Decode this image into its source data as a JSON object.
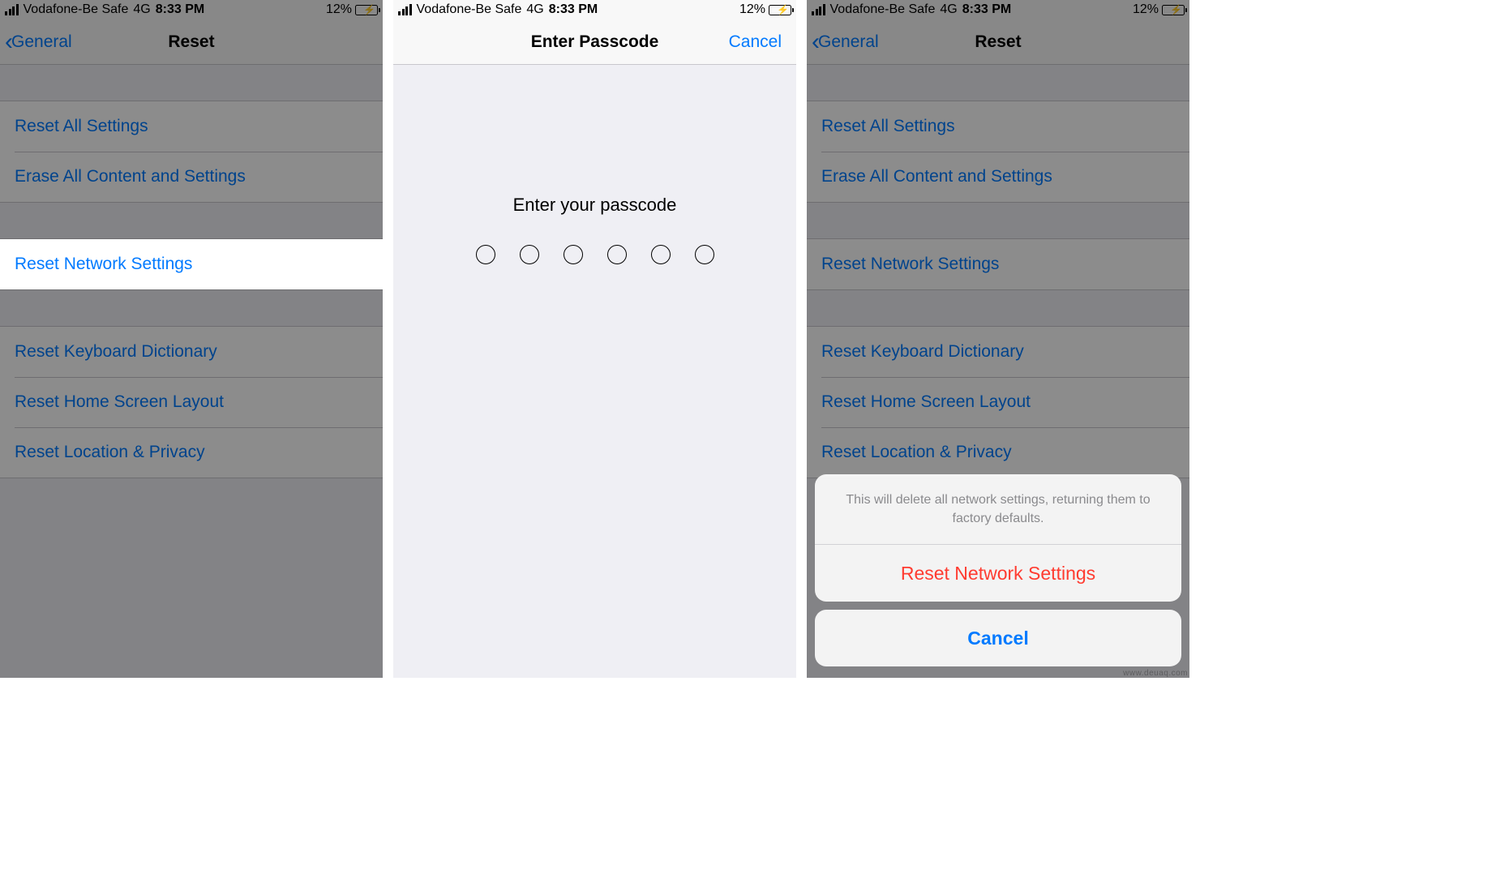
{
  "status": {
    "carrier": "Vodafone-Be Safe",
    "network": "4G",
    "time": "8:33 PM",
    "battery_pct": "12%"
  },
  "screen1": {
    "back": "General",
    "title": "Reset",
    "group1": {
      "item1": "Reset All Settings",
      "item2": "Erase All Content and Settings"
    },
    "group2": {
      "item1": "Reset Network Settings"
    },
    "group3": {
      "item1": "Reset Keyboard Dictionary",
      "item2": "Reset Home Screen Layout",
      "item3": "Reset Location & Privacy"
    }
  },
  "screen2": {
    "title": "Enter Passcode",
    "cancel": "Cancel",
    "prompt": "Enter your passcode"
  },
  "screen3": {
    "back": "General",
    "title": "Reset",
    "group1": {
      "item1": "Reset All Settings",
      "item2": "Erase All Content and Settings"
    },
    "group2": {
      "item1": "Reset Network Settings"
    },
    "group3": {
      "item1": "Reset Keyboard Dictionary",
      "item2": "Reset Home Screen Layout",
      "item3": "Reset Location & Privacy"
    },
    "sheet": {
      "message": "This will delete all network settings, returning them to factory defaults.",
      "action": "Reset Network Settings",
      "cancel": "Cancel"
    }
  },
  "watermark": "www.deuaq.com"
}
